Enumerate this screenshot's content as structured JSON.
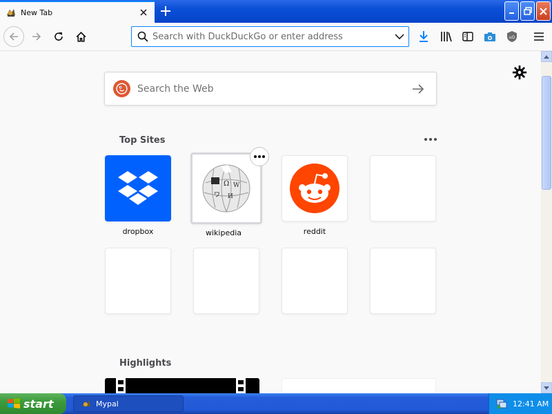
{
  "browser": {
    "tab": {
      "title": "New Tab",
      "favicon": "mypal-logo-icon"
    },
    "urlbar": {
      "placeholder": "Search with DuckDuckGo or enter address",
      "value": ""
    },
    "toolbar_icons": [
      "back-icon",
      "forward-icon",
      "reload-icon",
      "home-icon",
      "download-icon",
      "library-icon",
      "sidebar-icon",
      "screenshot-icon",
      "ublock-icon",
      "menu-icon"
    ]
  },
  "newtab": {
    "search": {
      "placeholder": "Search the Web",
      "engine_icon": "duckduckgo-icon"
    },
    "top_sites": {
      "title": "Top Sites",
      "items": [
        {
          "label": "dropbox",
          "icon": "dropbox-icon",
          "color": "#0061fe"
        },
        {
          "label": "wikipedia",
          "icon": "wikipedia-globe-icon",
          "color": "#ffffff"
        },
        {
          "label": "reddit",
          "icon": "reddit-icon",
          "color": "#ff4500"
        }
      ],
      "empty_slots": 5
    },
    "highlights": {
      "title": "Highlights"
    }
  },
  "taskbar": {
    "start_label": "start",
    "task_label": "Mypal",
    "clock": "12:41 AM"
  },
  "colors": {
    "accent": "#0a84ff",
    "xp_blue": "#245dda",
    "start_green": "#3c9a3c"
  }
}
